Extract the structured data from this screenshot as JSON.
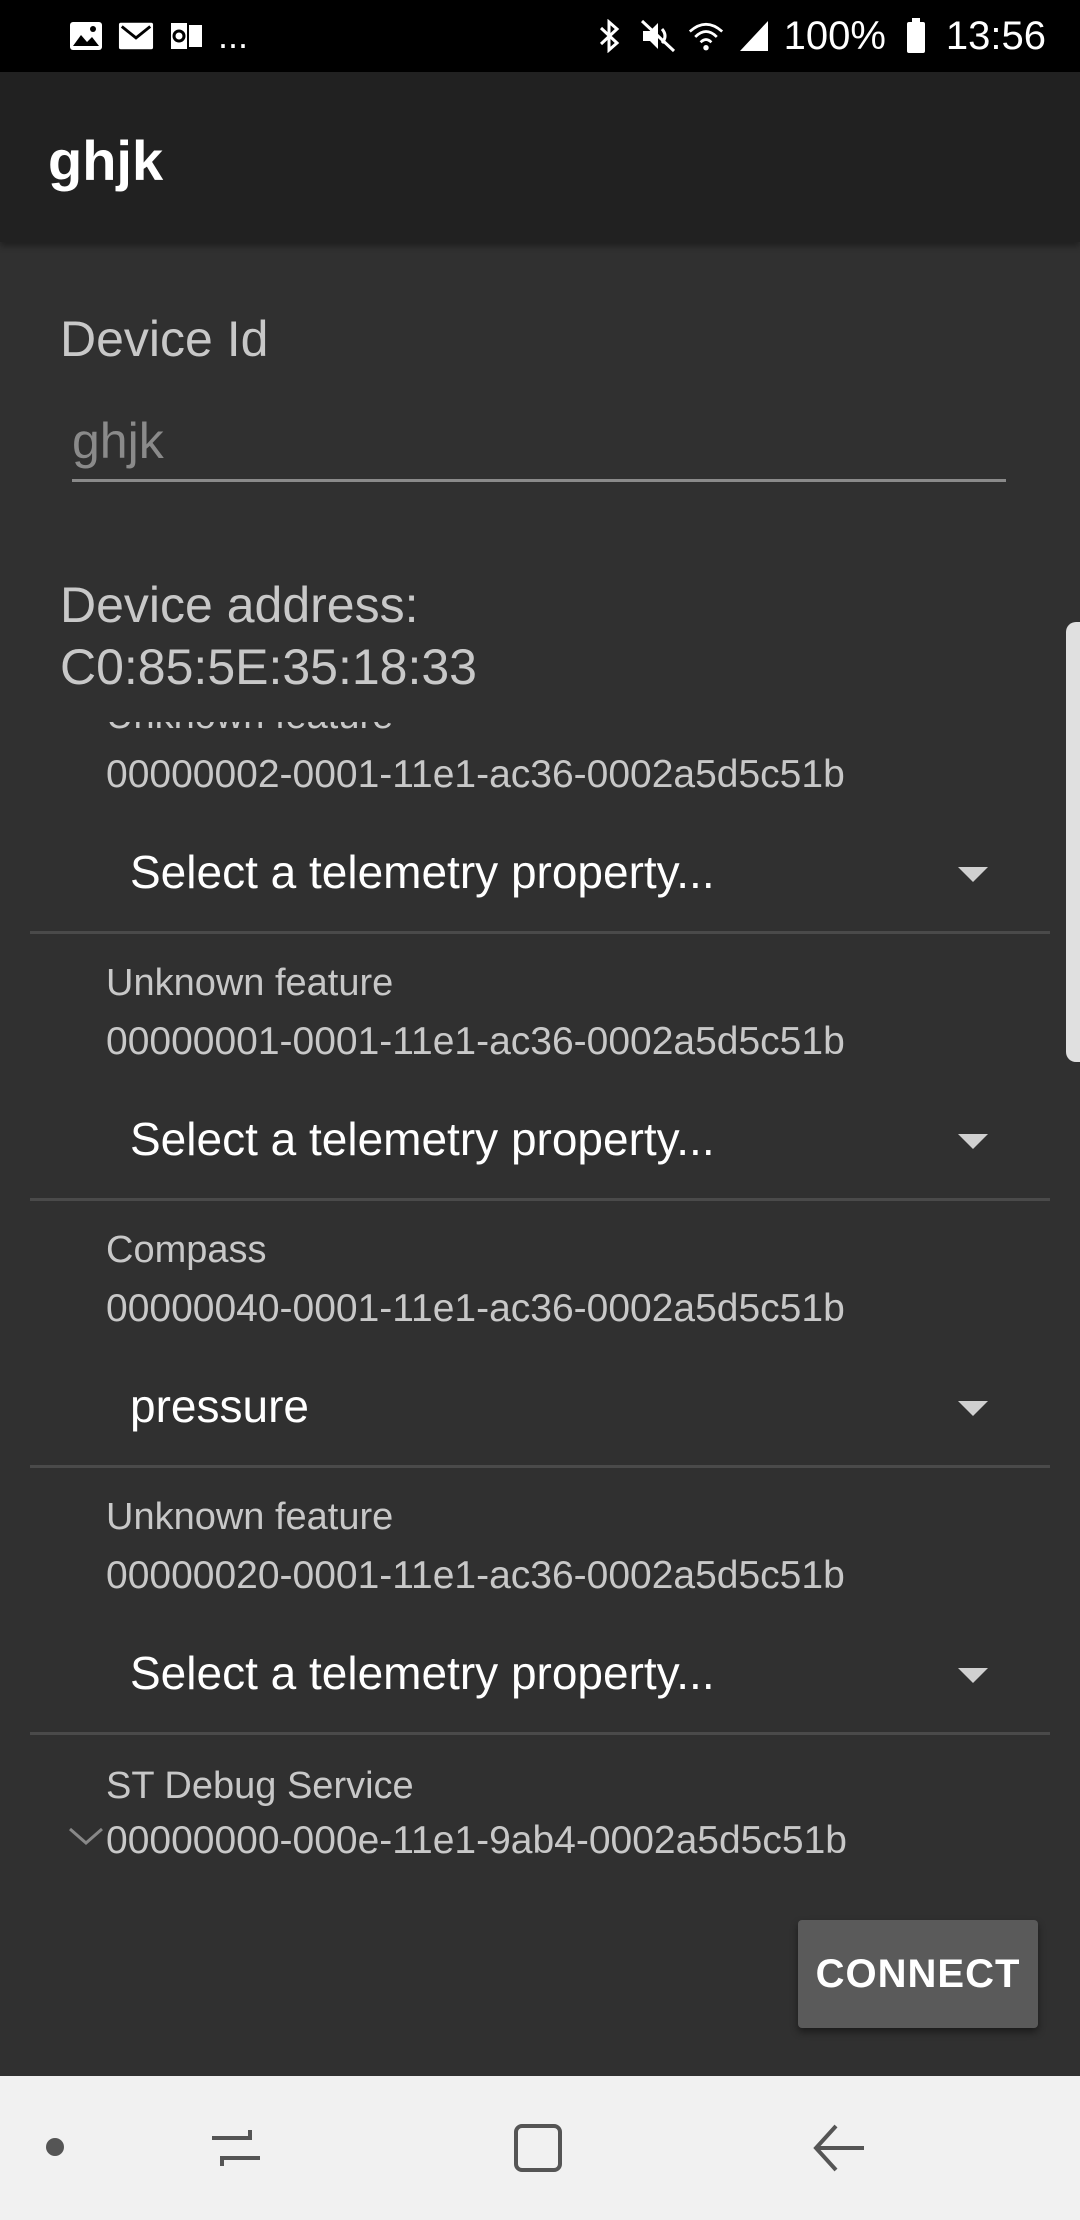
{
  "status_bar": {
    "battery": "100%",
    "time": "13:56",
    "more_indicator": "...",
    "left_icons": [
      "gallery-icon",
      "email-icon",
      "outlook-icon"
    ],
    "right_icons": [
      "bluetooth-icon",
      "mute-icon",
      "wifi-icon",
      "signal-icon",
      "battery-icon"
    ]
  },
  "app_bar": {
    "title": "ghjk"
  },
  "form": {
    "device_id_label": "Device Id",
    "device_id_value": "ghjk",
    "device_address_label": "Device address:",
    "device_address_value": "C0:85:5E:35:18:33"
  },
  "features": [
    {
      "name": "Unknown feature",
      "uuid": "00000002-0001-11e1-ac36-0002a5d5c51b",
      "selected": "Select a telemetry property..."
    },
    {
      "name": "Unknown feature",
      "uuid": "00000001-0001-11e1-ac36-0002a5d5c51b",
      "selected": "Select a telemetry property..."
    },
    {
      "name": "Compass",
      "uuid": "00000040-0001-11e1-ac36-0002a5d5c51b",
      "selected": "pressure"
    },
    {
      "name": "Unknown feature",
      "uuid": "00000020-0001-11e1-ac36-0002a5d5c51b",
      "selected": "Select a telemetry property..."
    }
  ],
  "service": {
    "name": "ST Debug Service",
    "uuid": "00000000-000e-11e1-9ab4-0002a5d5c51b"
  },
  "actions": {
    "connect_label": "CONNECT"
  },
  "colors": {
    "background": "#303030",
    "app_bar": "#212121",
    "status_bar": "#000000",
    "nav_bar": "#f1f1f1",
    "button": "#5a5a5a"
  }
}
